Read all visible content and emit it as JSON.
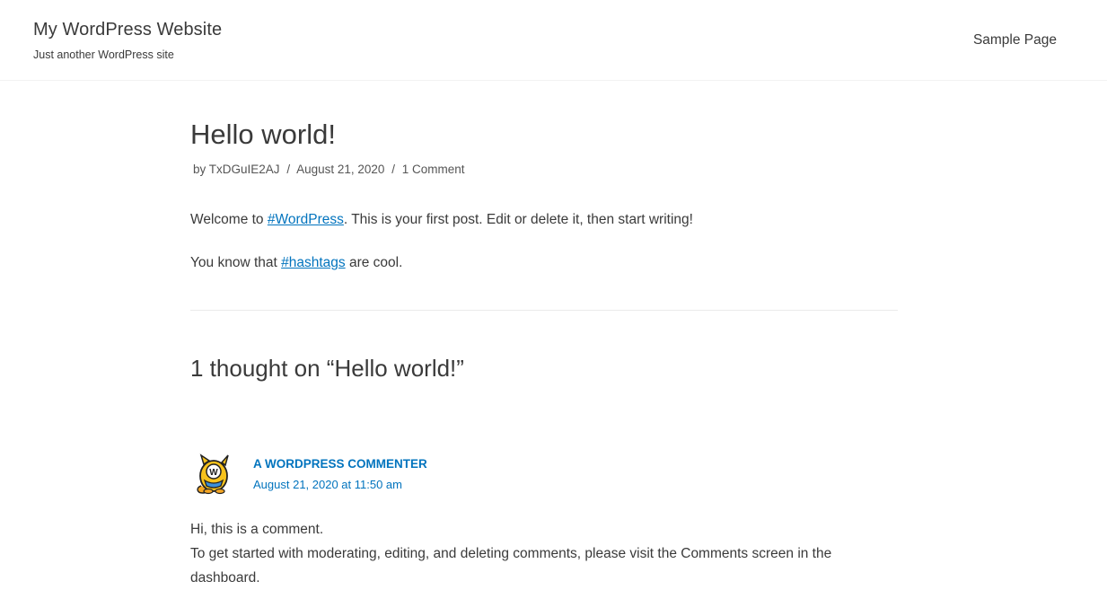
{
  "header": {
    "site_title": "My WordPress Website",
    "tagline": "Just another WordPress site",
    "nav": [
      {
        "label": "Sample Page"
      }
    ]
  },
  "post": {
    "title": "Hello world!",
    "meta": {
      "prefix": "by",
      "author": "TxDGuIE2AJ",
      "separator": "/",
      "date": "August 21, 2020",
      "comments_link": "1 Comment"
    },
    "paragraphs": [
      {
        "before": "Welcome to ",
        "link": "#WordPress",
        "after": ". This is your first post. Edit or delete it, then start writing!"
      },
      {
        "before": "You know that ",
        "link": "#hashtags",
        "after": " are cool."
      }
    ]
  },
  "comments": {
    "title": "1 thought on “Hello world!”",
    "items": [
      {
        "author": "A WordPress Commenter",
        "date": "August 21, 2020 at 11:50 am",
        "lines": [
          "Hi, this is a comment.",
          "To get started with moderating, editing, and deleting comments, please visit the Comments screen in the dashboard."
        ]
      }
    ]
  },
  "colors": {
    "link": "#0274be",
    "text": "#3a3a3a",
    "meta": "#555555"
  }
}
